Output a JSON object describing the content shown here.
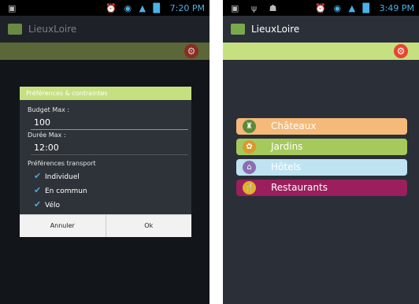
{
  "left": {
    "status": {
      "icons_left": "▣",
      "icons_right": "⏰ ◉ ▲ █",
      "time": "7:20 PM"
    },
    "app_title": "LieuxLoire",
    "gear_icon": "gear-icon",
    "dialog": {
      "title": "Préférences & contraintes",
      "budget_label": "Budget Max :",
      "budget_value": "100",
      "duration_label": "Durée Max :",
      "duration_value": "12:00",
      "transport_label": "Préférences transport",
      "options": [
        {
          "label": "Individuel",
          "checked": true
        },
        {
          "label": "En commun",
          "checked": true
        },
        {
          "label": "Vélo",
          "checked": true
        }
      ],
      "cancel_label": "Annuler",
      "ok_label": "Ok"
    }
  },
  "right": {
    "status": {
      "icons_left": "▣ ψ ☗",
      "icons_right": "⏰ ◉ ▲ █",
      "time": "3:49 PM"
    },
    "app_title": "LieuxLoire",
    "gear_icon": "gear-icon",
    "menu": [
      {
        "label": "Châteaux",
        "color": "#f5b97a",
        "icon": "castle-icon"
      },
      {
        "label": "Jardins",
        "color": "#a6c95c",
        "icon": "garden-icon"
      },
      {
        "label": "Hôtels",
        "color": "#bfe3f0",
        "icon": "hotel-icon"
      },
      {
        "label": "Restaurants",
        "color": "#9a1f5c",
        "icon": "restaurant-icon"
      }
    ]
  }
}
